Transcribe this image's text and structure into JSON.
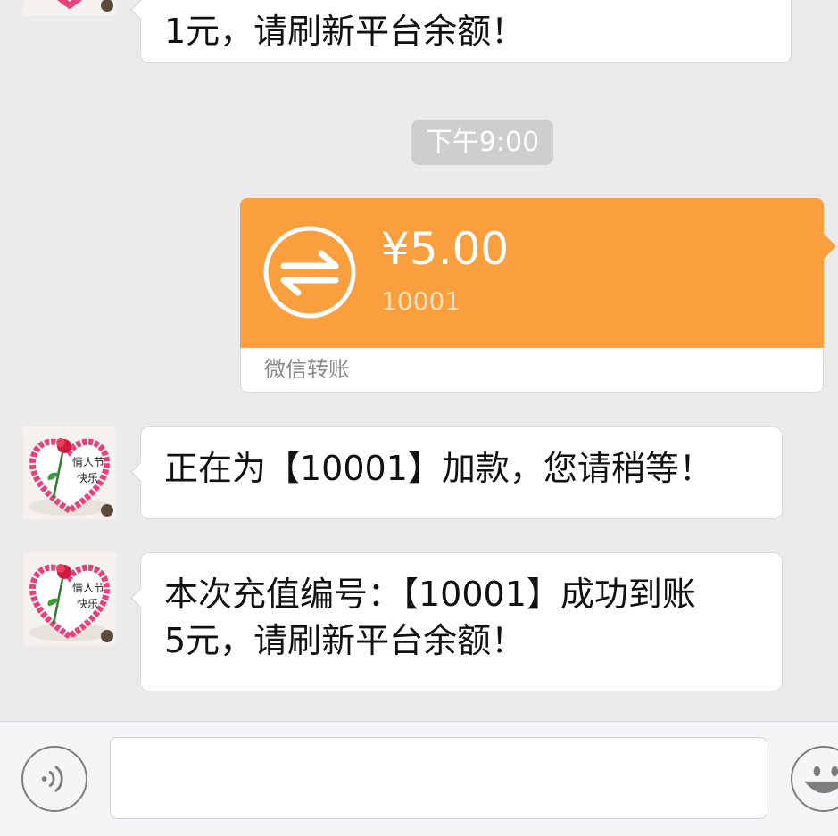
{
  "messages": {
    "top_partial": "1元，请刷新平台余额！",
    "msg1": "正在为【10001】加款，您请稍等！",
    "msg2_line1": "本次充值编号：【10001】成功到账",
    "msg2_line2": "5元，请刷新平台余额！"
  },
  "time_separator": "下午9:00",
  "transfer": {
    "amount": "¥5.00",
    "note": "10001",
    "label": "微信转账",
    "color": "#f99f3e"
  },
  "icons": {
    "voice": "voice-icon",
    "emoji": "emoji-icon",
    "transfer": "transfer-arrows-icon"
  },
  "colors": {
    "background": "#ebebeb",
    "bubble": "#ffffff",
    "time_pill": "#cecece"
  }
}
